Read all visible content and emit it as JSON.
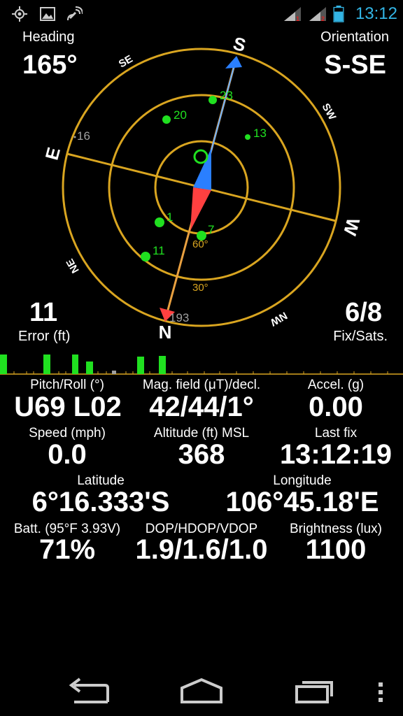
{
  "status_bar": {
    "time": "13:12",
    "left_icons": [
      "gps-icon",
      "image-icon",
      "satellite-icon"
    ],
    "right_icons": [
      "signal-sim1-icon",
      "signal-sim2-icon",
      "battery-icon"
    ]
  },
  "heading": {
    "label": "Heading",
    "value": "165°"
  },
  "orientation": {
    "label": "Orientation",
    "value": "S-SE"
  },
  "error": {
    "value": "11",
    "label": "Error (ft)"
  },
  "fix": {
    "value": "6/8",
    "label": "Fix/Sats."
  },
  "compass": {
    "rotation_deg": 165,
    "cardinals": {
      "S": "S",
      "E": "E",
      "W": "W",
      "N": "N"
    },
    "intercardinals": {
      "SE": "SE",
      "SW": "SW",
      "NE": "NE",
      "NW": "NW"
    },
    "ring_labels": {
      "elev60": "60°",
      "elev30": "30°"
    },
    "satellites": [
      {
        "id": "23",
        "fixed": true
      },
      {
        "id": "20",
        "fixed": true
      },
      {
        "id": "13",
        "fixed": true
      },
      {
        "id": "1",
        "fixed": true
      },
      {
        "id": "7",
        "fixed": true
      },
      {
        "id": "11",
        "fixed": true
      },
      {
        "id": "16",
        "fixed": false
      },
      {
        "id": "193",
        "fixed": false
      }
    ],
    "colors": {
      "ring": "#d9a520",
      "sat_fixed": "#20e020",
      "sat_other": "#a0a0a0",
      "needle_north": "#ff4040",
      "needle_south": "#2a7fff"
    }
  },
  "snr_bars": {
    "color": "#20e020"
  },
  "readings": {
    "pitch_roll": {
      "label": "Pitch/Roll (°)",
      "value": "U69 L02"
    },
    "mag_field": {
      "label": "Mag. field (μT)/decl.",
      "value": "42/44/1°"
    },
    "accel": {
      "label": "Accel. (g)",
      "value": "0.00"
    },
    "speed": {
      "label": "Speed (mph)",
      "value": "0.0"
    },
    "altitude": {
      "label": "Altitude (ft) MSL",
      "value": "368"
    },
    "last_fix": {
      "label": "Last fix",
      "value": "13:12:19"
    },
    "latitude": {
      "label": "Latitude",
      "value": "6°16.333'S"
    },
    "longitude": {
      "label": "Longitude",
      "value": "106°45.18'E"
    },
    "battery": {
      "label": "Batt. (95°F 3.93V)",
      "value": "71%"
    },
    "dop": {
      "label": "DOP/HDOP/VDOP",
      "value": "1.9/1.6/1.0"
    },
    "brightness": {
      "label": "Brightness (lux)",
      "value": "1100"
    }
  },
  "nav_bar": {
    "icons": [
      "back-icon",
      "home-icon",
      "recents-icon",
      "menu-icon"
    ]
  }
}
